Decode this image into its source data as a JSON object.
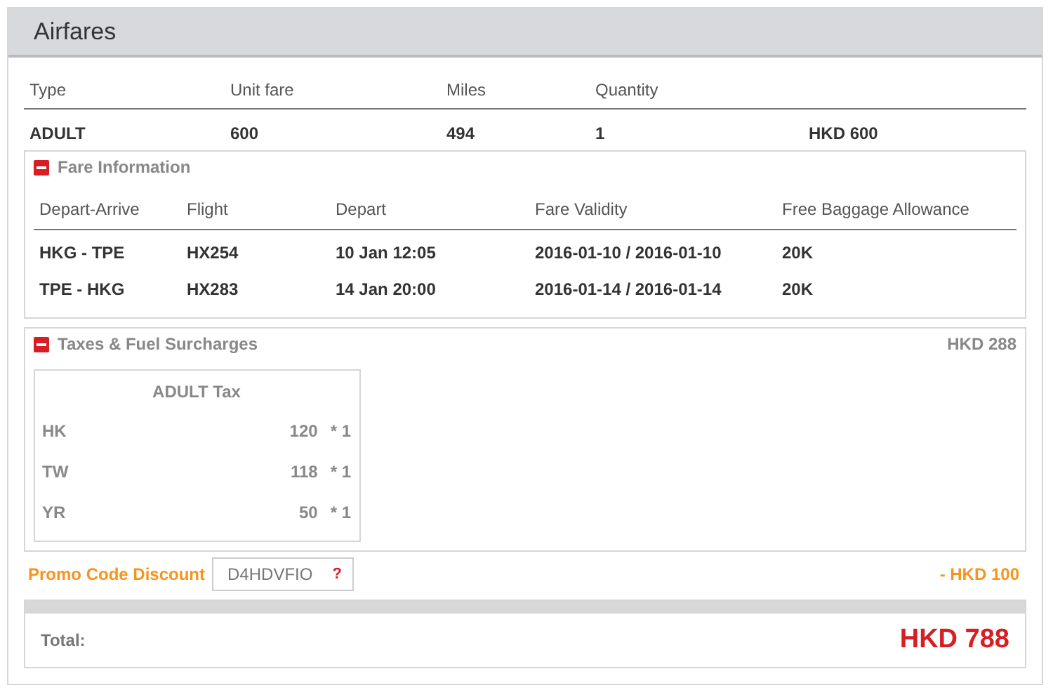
{
  "panel": {
    "title": "Airfares"
  },
  "fare_table": {
    "columns": [
      "Type",
      "Unit fare",
      "Miles",
      "Quantity"
    ],
    "rows": [
      {
        "type": "ADULT",
        "unit_fare": "600",
        "miles": "494",
        "quantity": "1",
        "total": "HKD 600"
      }
    ]
  },
  "fare_information": {
    "title": "Fare Information",
    "expanded": true,
    "columns": [
      "Depart-Arrive",
      "Flight",
      "Depart",
      "Fare Validity",
      "Free Baggage Allowance"
    ],
    "rows": [
      [
        "HKG - TPE",
        "HX254",
        "10 Jan 12:05",
        "2016-01-10 / 2016-01-10",
        "20K"
      ],
      [
        "TPE - HKG",
        "HX283",
        "14 Jan 20:00",
        "2016-01-14 / 2016-01-14",
        "20K"
      ]
    ]
  },
  "taxes": {
    "title": "Taxes & Fuel Surcharges",
    "expanded": true,
    "amount": "HKD 288",
    "table_title": "ADULT Tax",
    "rows": [
      {
        "code": "HK",
        "amount": "120",
        "multiplier": "* 1"
      },
      {
        "code": "TW",
        "amount": "118",
        "multiplier": "* 1"
      },
      {
        "code": "YR",
        "amount": "50",
        "multiplier": "* 1"
      }
    ]
  },
  "promo": {
    "label": "Promo Code Discount",
    "code": "D4HDVFIO",
    "help": "?",
    "discount": "- HKD 100"
  },
  "total": {
    "label": "Total:",
    "amount": "HKD 788"
  }
}
